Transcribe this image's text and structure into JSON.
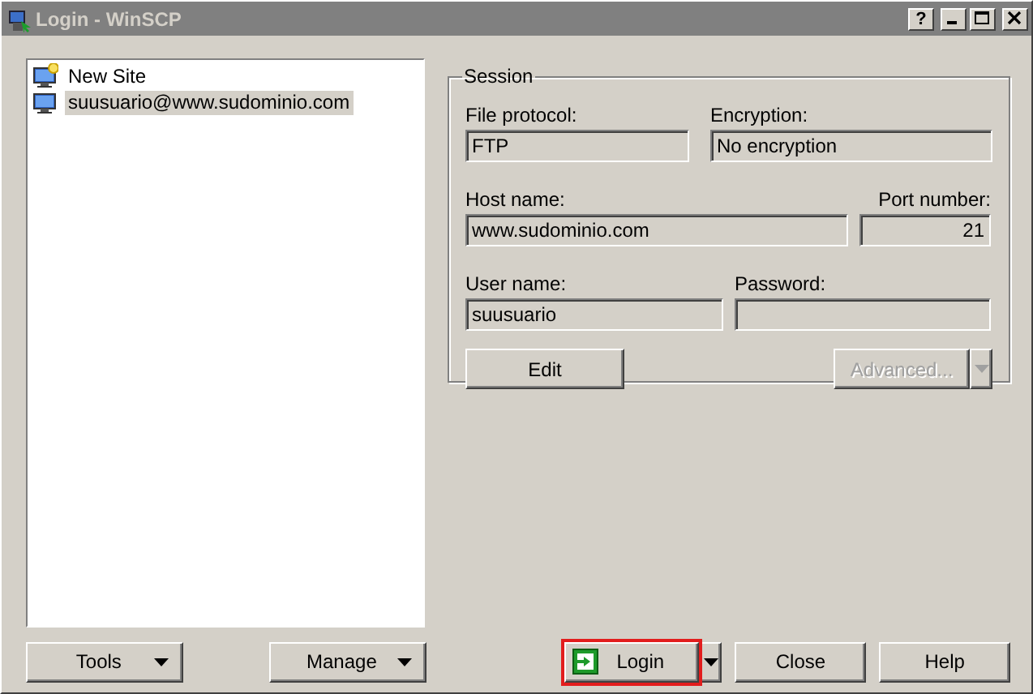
{
  "window": {
    "title": "Login - WinSCP",
    "help_button": "?"
  },
  "sites": [
    {
      "label": "New Site",
      "kind": "new",
      "selected": false
    },
    {
      "label": "suusuario@www.sudominio.com",
      "kind": "site",
      "selected": true
    }
  ],
  "session": {
    "title": "Session",
    "rows": [
      [
        {
          "label": "File protocol:",
          "value": "FTP",
          "kind": "text"
        },
        {
          "label": "Encryption:",
          "value": "No encryption",
          "kind": "text"
        }
      ],
      [
        {
          "label": "Host name:",
          "value": "www.sudominio.com",
          "kind": "text"
        },
        {
          "label": "Port number:",
          "value": "21",
          "kind": "number"
        }
      ],
      [
        {
          "label": "User name:",
          "value": "suusuario",
          "kind": "text"
        },
        {
          "label": "Password:",
          "kind": "password"
        }
      ]
    ],
    "edit_button": {
      "label": "Edit",
      "disabled": false
    },
    "advanced_button": {
      "label": "Advanced...",
      "disabled": true
    }
  },
  "buttons": [
    {
      "label": "Tools",
      "kind": "menu",
      "highlighted": false
    },
    {
      "label": "Manage",
      "kind": "menu",
      "highlighted": false
    },
    {
      "label": "Login",
      "kind": "split",
      "highlighted": true
    },
    {
      "label": "Close",
      "kind": "plain",
      "highlighted": false
    },
    {
      "label": "Help",
      "kind": "plain",
      "highlighted": false
    }
  ]
}
